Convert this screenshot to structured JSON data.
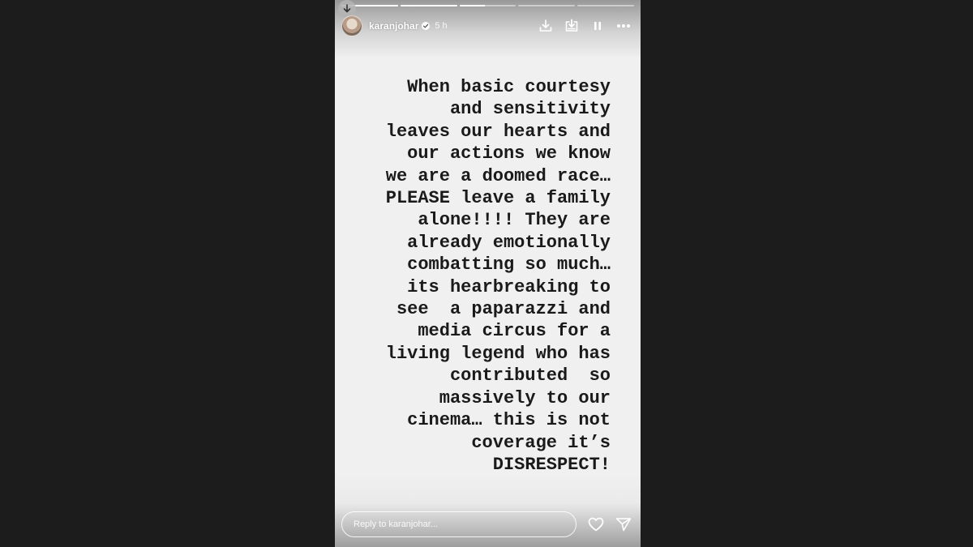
{
  "story": {
    "username": "karanjohar",
    "time_ago": "5 h",
    "segments": [
      1.0,
      1.0,
      0.45,
      0.0,
      0.0
    ],
    "text": "When basic courtesy\nand sensitivity\nleaves our hearts and\nour actions we know\nwe are a doomed race…\nPLEASE leave a family\nalone!!!! They are\nalready emotionally\ncombatting so much…\nits hearbreaking to\nsee  a paparazzi and\nmedia circus for a\nliving legend who has\ncontributed  so\nmassively to our\ncinema… this is not\ncoverage it’s\nDISRESPECT!",
    "background_color": "#f0f0f0",
    "text_color": "#1a1a1a"
  },
  "header": {
    "icons": [
      "download-icon",
      "save-to-device-icon",
      "pause-icon",
      "more-options-icon"
    ]
  },
  "reply": {
    "placeholder": "Reply to karanjohar..."
  },
  "footer": {
    "icons": [
      "heart-icon",
      "send-icon"
    ]
  }
}
